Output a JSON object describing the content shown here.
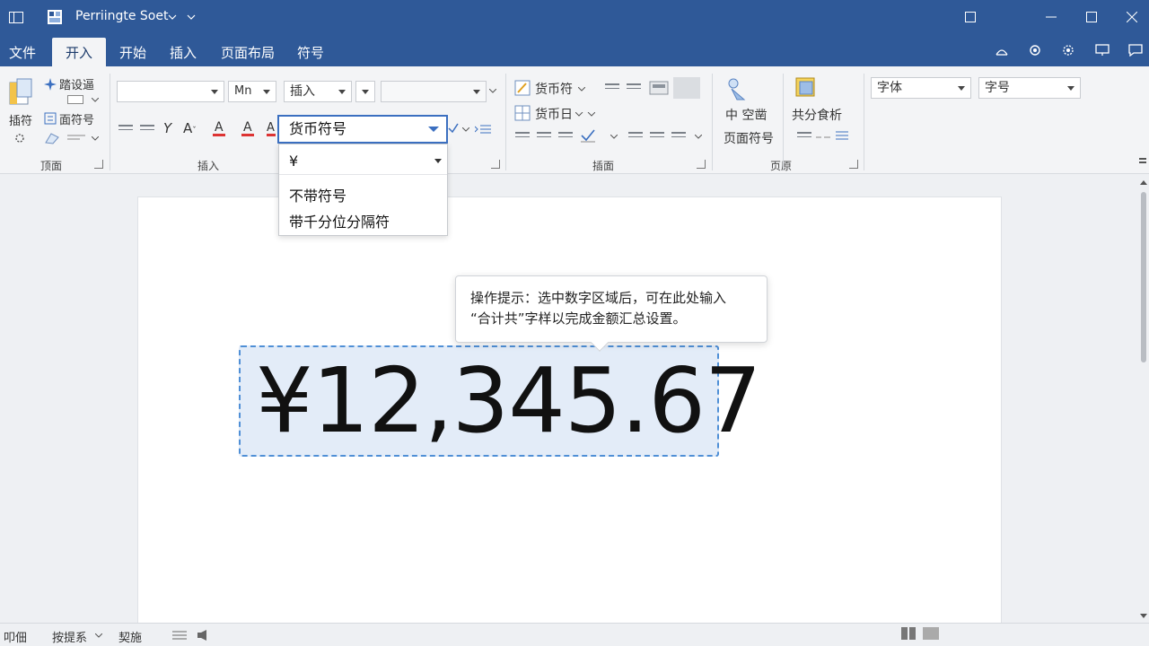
{
  "window": {
    "title": "Perriingte Soet",
    "colors": {
      "titlebar": "#2f5998",
      "accent": "#3b6fc0",
      "selection": "#e3ecf8"
    }
  },
  "menu": {
    "tabs": [
      {
        "label": "文件"
      },
      {
        "label": "开入",
        "active": true
      },
      {
        "label": "开始"
      },
      {
        "label": "插入"
      },
      {
        "label": "页面布局"
      },
      {
        "label": "符号"
      }
    ]
  },
  "ribbon": {
    "page_group": {
      "insert_label": "插符",
      "cmd1": "踏设逼",
      "cmd2": "面符号",
      "label": "顶面"
    },
    "insert_group": {
      "font_value": "",
      "size_value": "Mn",
      "insert_combo": "插入",
      "label": "插入"
    },
    "format_group": {
      "currency_btn": "货币符",
      "currency_date_btn": "货币日"
    },
    "insert_pic_group": {
      "label": "插面"
    },
    "page_symbol_group": {
      "center_btn": "中 空凿",
      "page_symbol_btn": "页面符号",
      "label": "页原"
    },
    "share_group": {
      "share_btn": "共分食析"
    },
    "font_combo": "字体",
    "size_combo": "字号"
  },
  "dropdown": {
    "selected": "货币符号",
    "symbol_value": "¥",
    "options": [
      "不带符号",
      "带千分位分隔符"
    ]
  },
  "document": {
    "amount": "¥12,345.67",
    "tooltip_line1": "操作提示：选中数字区域后，可在此处输入",
    "tooltip_line2": "“合计共”字样以完成金额汇总设置。"
  },
  "statusbar": {
    "page": "叩佃",
    "search": "按提系",
    "words": "契施"
  }
}
